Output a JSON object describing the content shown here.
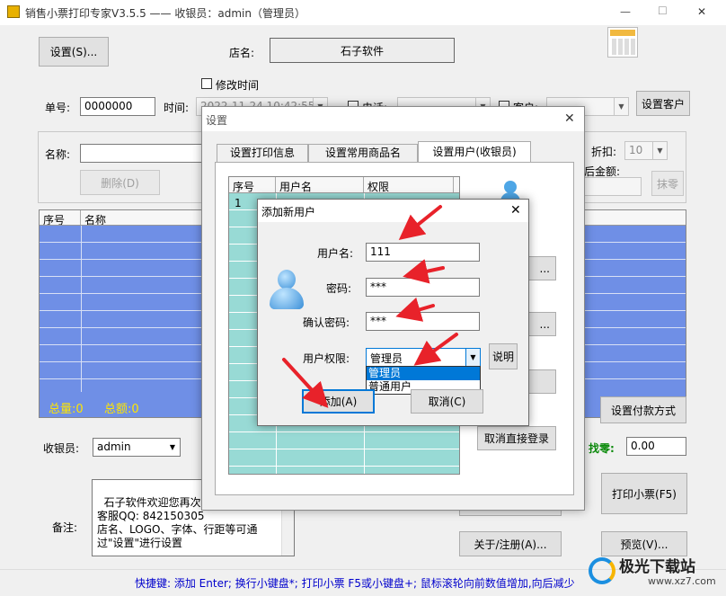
{
  "window": {
    "title": "销售小票打印专家V3.5.5 —— 收银员：admin（管理员）",
    "controls": {
      "minimize": "—",
      "maximize": "☐",
      "close": "✕"
    }
  },
  "main": {
    "settings_button": "设置(S)...",
    "store_label": "店名:",
    "store_name": "石子软件",
    "modify_time_label": "修改时间",
    "order_label": "单号:",
    "order_value": "0000000",
    "time_label": "时间:",
    "time_value": "2022-11-24 10:42:55",
    "phone_label": "电话:",
    "customer_label": "客户:",
    "set_customer_button": "设置客户",
    "name_label": "名称:",
    "delete_button": "删除(D)",
    "discount_label": "折扣:",
    "discount_value": "10",
    "after_amount_label": "后金额:",
    "erase_button": "抹零",
    "grid_headers": [
      "序号",
      "名称"
    ],
    "total_qty": "总量:0",
    "total_amount": "总额:0",
    "payment_button": "设置付款方式",
    "cashier_label": "收银员:",
    "cashier_value": "admin",
    "change_label": "找零:",
    "change_value": "0.00",
    "note_text": "石子软件欢迎您再次光临\n客服QQ: 842150305\n店名、LOGO、字体、行距等可通过\"设置\"进行设置",
    "note_label": "备注:",
    "print_button": "打印小票(F5)",
    "about_button": "关于/注册(A)...",
    "preview_button": "预览(V)...",
    "status_bar": "快捷键: 添加 Enter; 换行小键盘*; 打印小票 F5或小键盘+; 鼠标滚轮向前数值增加,向后减少"
  },
  "settings_dialog": {
    "title": "设置",
    "tabs": [
      "设置打印信息",
      "设置常用商品名",
      "设置用户(收银员)"
    ],
    "user_grid_headers": [
      "序号",
      "用户名",
      "权限"
    ],
    "user_grid_rows": [
      {
        "no": "1"
      }
    ],
    "cancel_direct_login_button": "取消直接登录",
    "side_button_ellipsis": "..."
  },
  "add_user_dialog": {
    "title": "添加新用户",
    "username_label": "用户名:",
    "username_value": "111",
    "password_label": "密码:",
    "password_value": "***",
    "confirm_label": "确认密码:",
    "confirm_value": "***",
    "permission_label": "用户权限:",
    "permission_value": "管理员",
    "permission_options": [
      "管理员",
      "普通用户"
    ],
    "explain_button": "说明",
    "add_button": "添加(A)",
    "cancel_button": "取消(C)"
  },
  "watermark": {
    "text": "极光下载站",
    "url": "www.xz7.com"
  },
  "colors": {
    "accent": "#0078d7",
    "grid_blue": "#6f8fe6",
    "teal": "#98dad5",
    "arrow": "#e8222a",
    "status_blue": "#0000cc"
  }
}
